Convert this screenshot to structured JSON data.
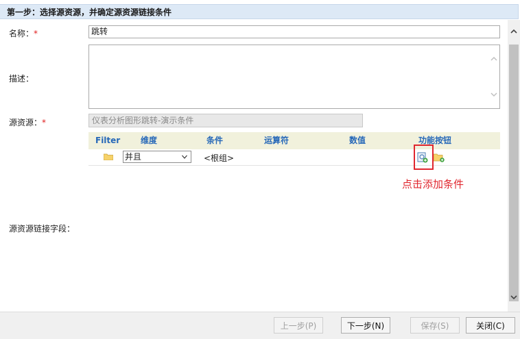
{
  "header": {
    "title": "第一步：选择源资源，并确定源资源链接条件"
  },
  "form": {
    "name_label": "名称：",
    "name_value": "跳转",
    "desc_label": "描述：",
    "source_label": "源资源：",
    "source_value": "仪表分析图形跳转-演示条件",
    "link_label": "源资源链接字段：",
    "required_mark": "*"
  },
  "grid": {
    "columns": [
      "Filter",
      "维度",
      "条件",
      "运算符",
      "数值",
      "功能按钮"
    ],
    "row": {
      "select_value": "并且",
      "condition": "<根组>",
      "icons": [
        "folder-icon",
        "add-condition-icon",
        "add-group-icon"
      ]
    }
  },
  "annotation": {
    "text": "点击添加条件",
    "color": "#e0262e"
  },
  "footer": {
    "prev_label": "上一步(P)",
    "next_label": "下一步(N)",
    "save_label": "保存(S)",
    "close_label": "关闭(C)"
  },
  "colors": {
    "header_bg": "#dde9f6",
    "grid_head_bg": "#f1f1dc",
    "grid_head_text": "#2668b8"
  }
}
